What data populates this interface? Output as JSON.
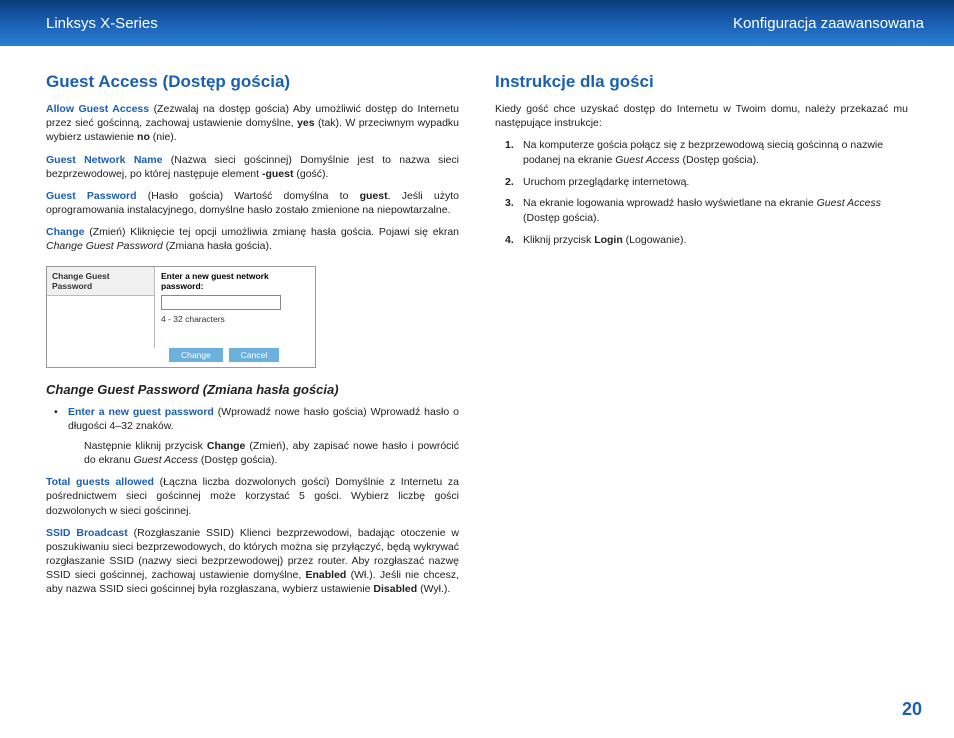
{
  "header": {
    "left": "Linksys X-Series",
    "right": "Konfiguracja zaawansowana"
  },
  "left_col": {
    "h_guest_access": "Guest Access (Dostęp gościa)",
    "p1_term": "Allow Guest Access",
    "p1_rest": " (Zezwalaj na dostęp gościa)  Aby umożliwić dostęp do Internetu przez sieć gościnną, zachowaj ustawienie domyślne, ",
    "p1_yes": "yes",
    "p1_rest2": " (tak). W przeciwnym wypadku wybierz ustawienie ",
    "p1_no": "no",
    "p1_rest3": " (nie).",
    "p2_term": "Guest Network Name",
    "p2_rest": " (Nazwa sieci gościnnej) Domyślnie jest to nazwa sieci bezprzewodowej, po której następuje element ",
    "p2_suffix": "-guest",
    "p2_rest2": " (gość).",
    "p3_term": "Guest Password",
    "p3_rest": " (Hasło gościa)  Wartość domyślna to ",
    "p3_guest": "guest",
    "p3_rest2": ". Jeśli użyto oprogramowania instalacyjnego, domyślne hasło zostało zmienione na niepowtarzalne.",
    "p4_term": "Change",
    "p4_rest": " (Zmień) Kliknięcie tej opcji umożliwia zmianę hasła gościa. Pojawi się ekran ",
    "p4_italic": "Change Guest Password",
    "p4_rest2": " (Zmiana hasła gościa).",
    "dialog": {
      "left_title": "Change Guest Password",
      "right_label": "Enter a new guest network password:",
      "hint": "4 - 32 characters",
      "btn_change": "Change",
      "btn_cancel": "Cancel"
    },
    "h_change": "Change Guest Password (Zmiana hasła gościa)",
    "b1_term": "Enter a new guest password",
    "b1_rest": " (Wprowadź nowe hasło gościa) Wprowadź hasło o długości 4–32 znaków.",
    "sub_p": "Następnie kliknij przycisk ",
    "sub_change": "Change",
    "sub_rest": " (Zmień), aby zapisać nowe hasło i powrócić do ekranu ",
    "sub_italic": "Guest Access",
    "sub_rest2": " (Dostęp gościa).",
    "p5_term": "Total guests allowed",
    "p5_rest": " (Łączna liczba dozwolonych gości) Domyślnie z Internetu za pośrednictwem sieci gościnnej może korzystać 5 gości. Wybierz liczbę gości dozwolonych w sieci gościnnej.",
    "p6_term": "SSID Broadcast",
    "p6_rest": " (Rozgłaszanie SSID) Klienci bezprzewodowi, badając otoczenie w poszukiwaniu sieci bezprzewodowych, do których można się przyłączyć, będą wykrywać rozgłaszanie SSID (nazwy sieci bezprzewodowej) przez router. Aby rozgłaszać nazwę SSID sieci gościnnej, zachowaj ustawienie domyślne, ",
    "p6_enabled": "Enabled",
    "p6_rest2": " (Wł.). Jeśli nie chcesz, aby nazwa SSID sieci gościnnej była rozgłaszana, wybierz ustawienie ",
    "p6_disabled": "Disabled",
    "p6_rest3": " (Wył.)."
  },
  "right_col": {
    "h_instr": "Instrukcje dla gości",
    "intro": "Kiedy gość chce uzyskać dostęp do Internetu w Twoim domu, należy przekazać mu następujące instrukcje:",
    "li1a": "Na komputerze gościa połącz się z bezprzewodową siecią gościnną o nazwie podanej na ekranie ",
    "li1_italic": "Guest Access",
    "li1b": " (Dostęp gościa).",
    "li2": "Uruchom przeglądarkę internetową.",
    "li3a": "Na ekranie logowania wprowadź hasło wyświetlane na ekranie ",
    "li3_italic": "Guest Access",
    "li3b": " (Dostęp gościa).",
    "li4a": "Kliknij przycisk ",
    "li4_login": "Login",
    "li4b": " (Logowanie)."
  },
  "page_number": "20"
}
